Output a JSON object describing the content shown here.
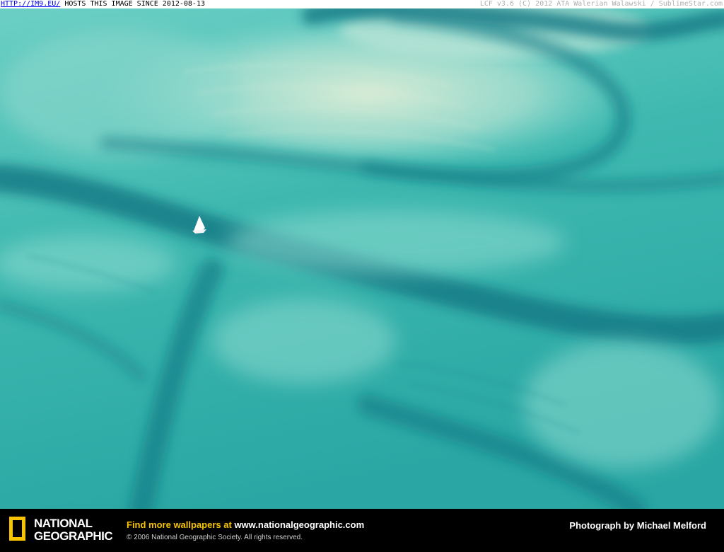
{
  "topbar": {
    "link_text": "HTTP://IM9.EU/",
    "hosts_text": " HOSTS THIS IMAGE SINCE 2012-08-13",
    "right_text": "LCF v3.6 (C) 2012 ATA Walerian Walawski / SublimeStar.com"
  },
  "photo": {
    "subject": "Aerial view of turquoise shallow water with sand bars and a small white sailboat",
    "colors": {
      "water_light": "#8fdcd0",
      "water_mid": "#3fb9b0",
      "channel_dark": "#127a86",
      "sand": "#d4e8d0"
    }
  },
  "footer": {
    "logo_line1": "NATIONAL",
    "logo_line2": "GEOGRAPHIC",
    "promo_prefix": "Find more wallpapers at ",
    "promo_url": "www.nationalgeographic.com",
    "copyright": "© 2006 National Geographic Society. All rights reserved.",
    "credit": "Photograph by Michael Melford",
    "colors": {
      "accent": "#f7c400",
      "background": "#000000"
    }
  }
}
